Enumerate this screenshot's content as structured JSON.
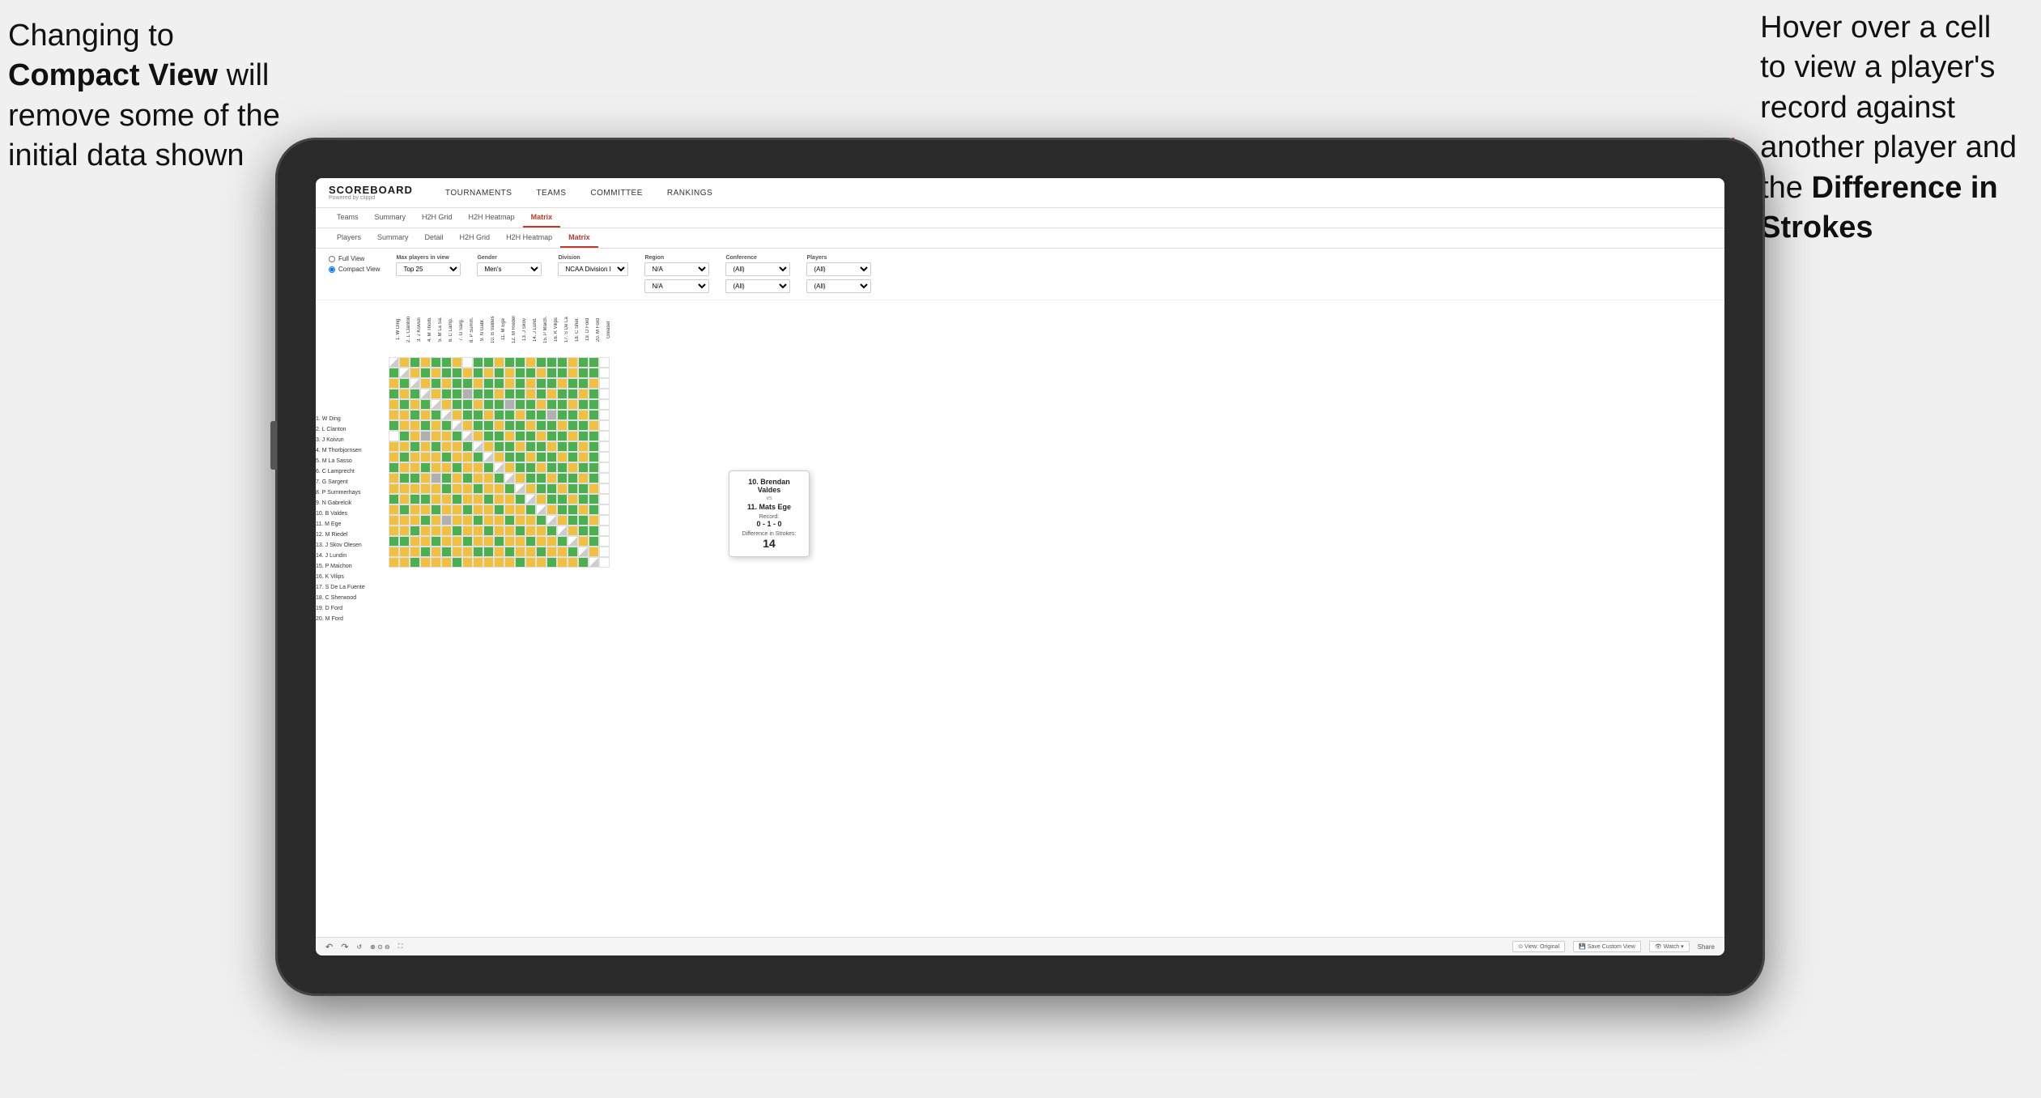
{
  "annotation_left": {
    "line1": "Changing to",
    "line2_bold": "Compact View",
    "line2_rest": " will",
    "line3": "remove some of the",
    "line4": "initial data shown"
  },
  "annotation_right": {
    "line1": "Hover over a cell",
    "line2": "to view a player's",
    "line3": "record against",
    "line4": "another player and",
    "line5_pre": "the ",
    "line5_bold": "Difference in",
    "line6_bold": "Strokes"
  },
  "nav": {
    "logo": "SCOREBOARD",
    "logo_sub": "Powered by clippd",
    "items": [
      "TOURNAMENTS",
      "TEAMS",
      "COMMITTEE",
      "RANKINGS"
    ]
  },
  "tabs_outer": {
    "items": [
      "Teams",
      "Summary",
      "H2H Grid",
      "H2H Heatmap",
      "Matrix"
    ]
  },
  "tabs_inner": {
    "items": [
      "Players",
      "Summary",
      "Detail",
      "H2H Grid",
      "H2H Heatmap",
      "Matrix"
    ],
    "active": "Matrix"
  },
  "filters": {
    "view_options": [
      "Full View",
      "Compact View"
    ],
    "max_players_label": "Max players in view",
    "max_players_value": "Top 25",
    "gender_label": "Gender",
    "gender_value": "Men's",
    "division_label": "Division",
    "division_value": "NCAA Division I",
    "region_label": "Region",
    "region_values": [
      "N/A",
      "N/A"
    ],
    "conference_label": "Conference",
    "conference_values": [
      "(All)",
      "(All)"
    ],
    "players_label": "Players",
    "players_values": [
      "(All)",
      "(All)"
    ]
  },
  "players": [
    "1. W Ding",
    "2. L Clanton",
    "3. J Koivun",
    "4. M Thorbjornsen",
    "5. M La Sasso",
    "6. C Lamprecht",
    "7. G Sargent",
    "8. P Summerhays",
    "9. N Gabrelcik",
    "10. B Valdes",
    "11. M Ege",
    "12. M Riedel",
    "13. J Skov Olesen",
    "14. J Lundin",
    "15. P Maichon",
    "16. K Vilips",
    "17. S De La Fuente",
    "18. C Sherwood",
    "19. D Ford",
    "20. M Ford"
  ],
  "col_headers": [
    "1. W Ding",
    "2. L Clanton",
    "3. J Koivun",
    "4. M Thorb.",
    "5. M La Sa.",
    "6. C Lamp.",
    "7. G Sarg.",
    "8. P Summ.",
    "9. N Gabr.",
    "10. B Valdes",
    "11. M Ege",
    "12. M Riedel",
    "13. J Skov",
    "14. J Lund.",
    "15. P Maich.",
    "16. K Vilips",
    "17. S De La",
    "18. C Sher.",
    "19. D Ford",
    "20. M Ford",
    "Greaser"
  ],
  "tooltip": {
    "player1": "10. Brendan Valdes",
    "vs": "vs",
    "player2": "11. Mats Ege",
    "record_label": "Record:",
    "record": "0 - 1 - 0",
    "diff_label": "Difference in Strokes:",
    "diff_value": "14"
  },
  "toolbar": {
    "undo": "↶",
    "redo": "↷",
    "view_original": "⊙ View: Original",
    "save_custom": "💾 Save Custom View",
    "watch": "👁 Watch ▾",
    "share": "Share"
  },
  "colors": {
    "green": "#4caf50",
    "yellow": "#f0c040",
    "gray": "#b0b0b0",
    "white": "#ffffff",
    "active_tab": "#c0392b"
  }
}
